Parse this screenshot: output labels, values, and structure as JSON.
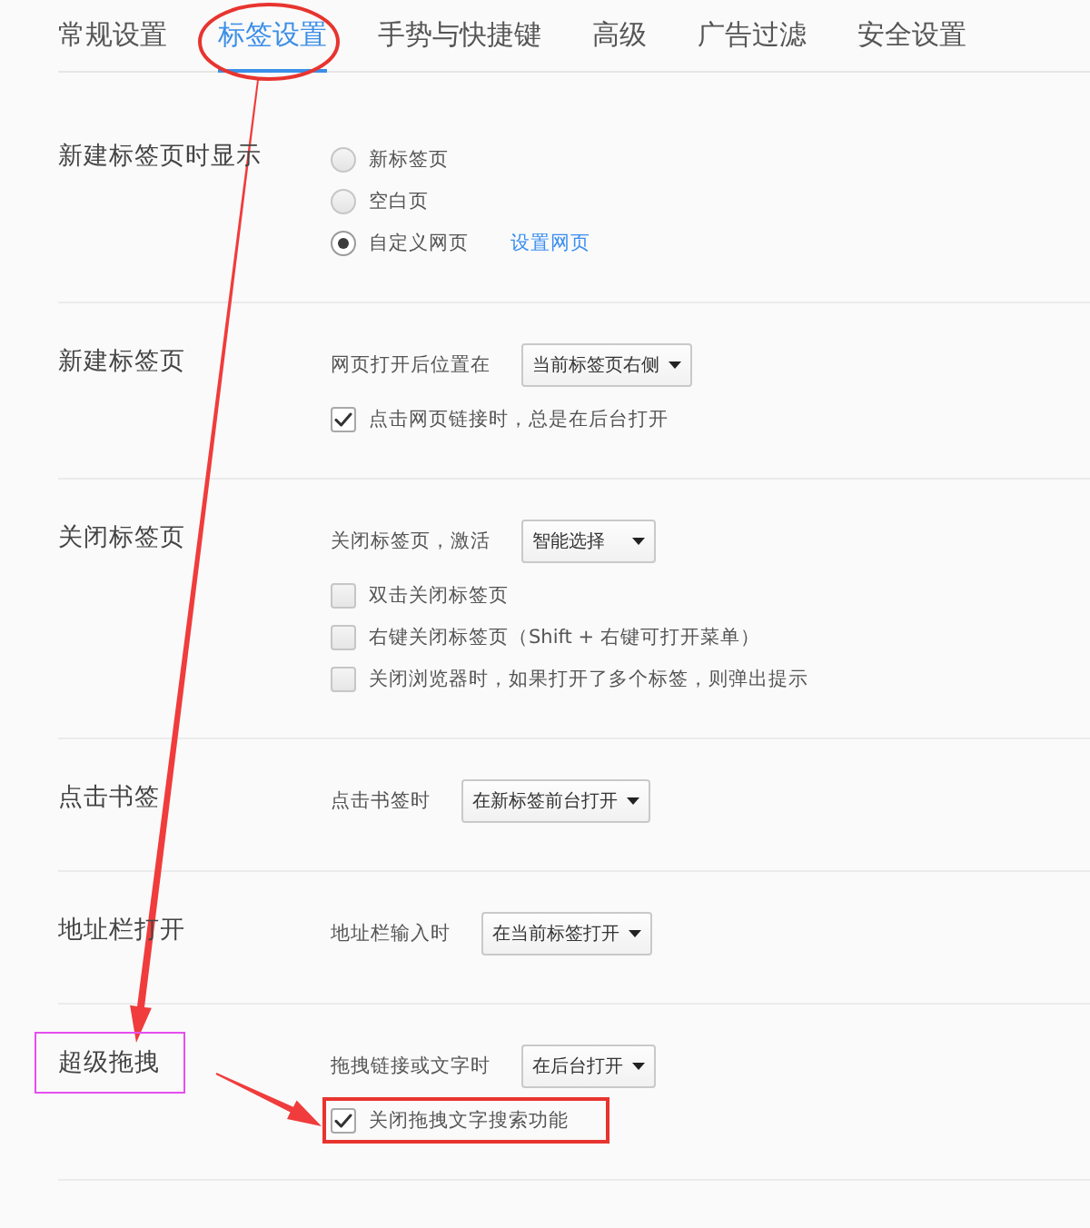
{
  "tabs": [
    {
      "label": "常规设置",
      "selected": false
    },
    {
      "label": "标签设置",
      "selected": true
    },
    {
      "label": "手势与快捷键",
      "selected": false
    },
    {
      "label": "高级",
      "selected": false
    },
    {
      "label": "广告过滤",
      "selected": false
    },
    {
      "label": "安全设置",
      "selected": false
    }
  ],
  "sections": [
    {
      "title": "新建标签页时显示",
      "rows": [
        {
          "kind": "radio",
          "label": "新标签页",
          "selected": false
        },
        {
          "kind": "radio",
          "label": "空白页",
          "selected": false
        },
        {
          "kind": "radio",
          "label": "自定义网页",
          "selected": true,
          "link": "设置网页"
        }
      ]
    },
    {
      "title": "新建标签页",
      "rows": [
        {
          "kind": "select",
          "label": "网页打开后位置在",
          "value": "当前标签页右侧"
        },
        {
          "kind": "checkbox",
          "label": "点击网页链接时，总是在后台打开",
          "checked": true
        }
      ]
    },
    {
      "title": "关闭标签页",
      "rows": [
        {
          "kind": "select",
          "label": "关闭标签页，激活",
          "value": "智能选择"
        },
        {
          "kind": "checkbox",
          "label": "双击关闭标签页",
          "checked": false
        },
        {
          "kind": "checkbox",
          "label": "右键关闭标签页（Shift + 右键可打开菜单）",
          "checked": false
        },
        {
          "kind": "checkbox",
          "label": "关闭浏览器时，如果打开了多个标签，则弹出提示",
          "checked": false
        }
      ]
    },
    {
      "title": "点击书签",
      "rows": [
        {
          "kind": "select",
          "label": "点击书签时",
          "value": "在新标签前台打开"
        }
      ]
    },
    {
      "title": "地址栏打开",
      "rows": [
        {
          "kind": "select",
          "label": "地址栏输入时",
          "value": "在当前标签打开"
        }
      ]
    },
    {
      "title": "超级拖拽",
      "rows": [
        {
          "kind": "select",
          "label": "拖拽链接或文字时",
          "value": "在后台打开"
        },
        {
          "kind": "checkbox",
          "label": "关闭拖拽文字搜索功能",
          "checked": true
        }
      ]
    }
  ]
}
